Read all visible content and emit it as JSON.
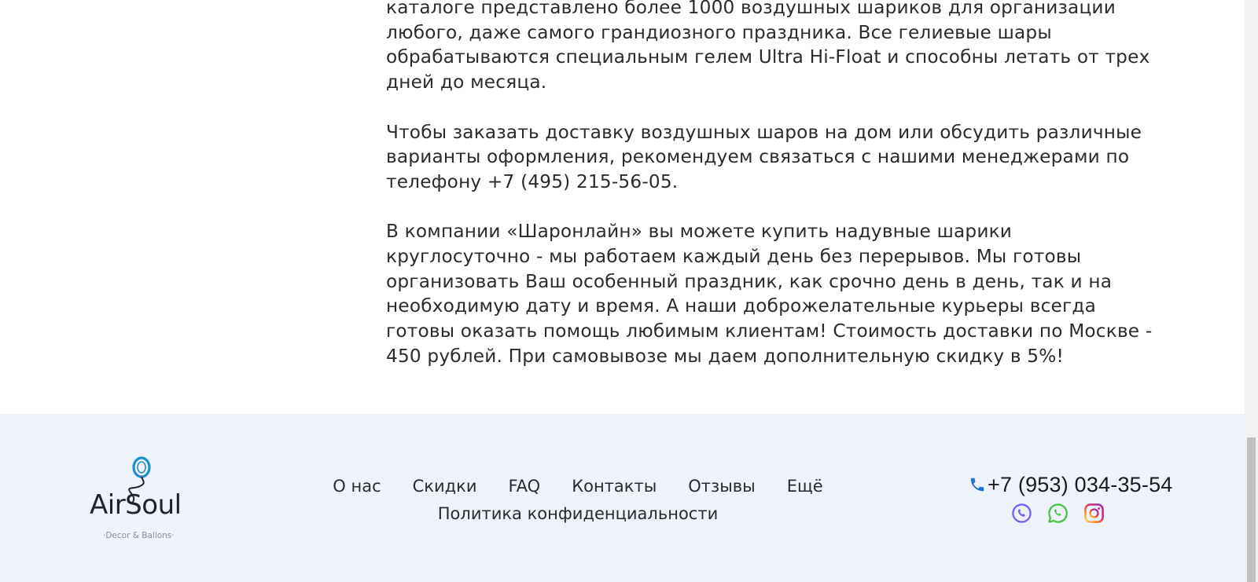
{
  "article": {
    "p1": "каталоге представлено более 1000 воздушных шариков для организации любого, даже самого грандиозного праздника. Все гелиевые шары обрабатываются специальным гелем Ultra Hi-Float и способны летать от трех дней до месяца.",
    "p2": "Чтобы заказать доставку воздушных шаров на дом или обсудить различные варианты оформления, рекомендуем связаться с нашими менеджерами по телефону +7 (495) 215-56-05.",
    "p3": "В компании «Шаронлайн» вы можете купить надувные шарики круглосуточно - мы работаем каждый день без перерывов. Мы готовы организовать Ваш особенный праздник, как срочно день в день, так и на необходимую дату и время. А наши доброжелательные курьеры всегда готовы оказать помощь любимым клиентам! Стоимость доставки по Москве - 450 рублей. При самовывозе мы даем дополнительную скидку в 5%!"
  },
  "footer": {
    "logo": {
      "word": "AirSoul",
      "tagline": "·Decor &  Ballons·"
    },
    "nav": {
      "row1": [
        "О нас",
        "Скидки",
        "FAQ",
        "Контакты",
        "Отзывы",
        "Ещё"
      ],
      "row2": [
        "Политика конфиденциальности"
      ]
    },
    "contact": {
      "phone": "+7 (953) 034-35-54",
      "phone_icon": "phone-icon",
      "socials": [
        "viber-icon",
        "whatsapp-icon",
        "instagram-icon"
      ]
    }
  },
  "colors": {
    "footer_bg": "#eef2fb",
    "logo_blue": "#1b8fc9",
    "phone_blue": "#1a73d9",
    "viber": "#7360f2",
    "whatsapp": "#4dc247"
  }
}
